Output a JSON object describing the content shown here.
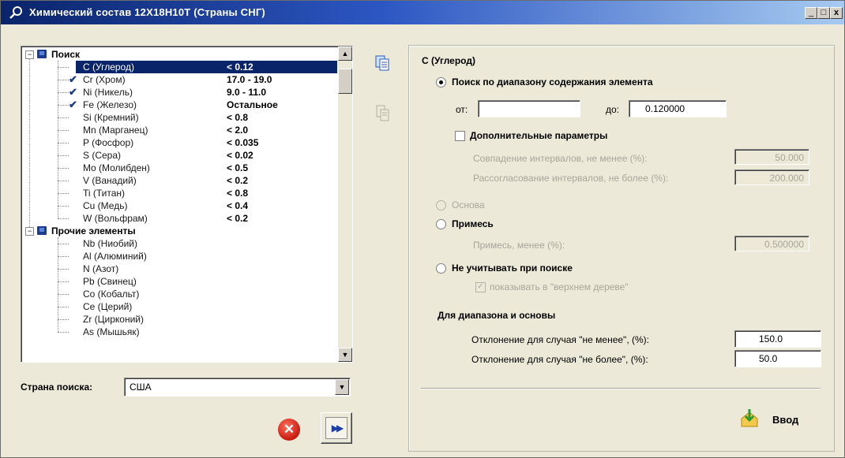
{
  "window": {
    "title": "Химический состав 12Х18Н10Т (Страны СНГ)",
    "min_icon": "_",
    "max_icon": "□",
    "close_icon": "x"
  },
  "tree": {
    "groups": [
      {
        "label": "Поиск",
        "items": [
          {
            "name": "C (Углерод)",
            "value": "< 0.12",
            "checked": false,
            "selected": true
          },
          {
            "name": "Cr (Хром)",
            "value": "17.0 - 19.0",
            "checked": true
          },
          {
            "name": "Ni (Никель)",
            "value": "9.0 - 11.0",
            "checked": true
          },
          {
            "name": "Fe (Железо)",
            "value": "Остальное",
            "checked": true
          },
          {
            "name": "Si (Кремний)",
            "value": "< 0.8",
            "checked": false
          },
          {
            "name": "Mn (Марганец)",
            "value": "< 2.0",
            "checked": false
          },
          {
            "name": "P (Фосфор)",
            "value": "< 0.035",
            "checked": false
          },
          {
            "name": "S (Сера)",
            "value": "< 0.02",
            "checked": false
          },
          {
            "name": "Mo (Молибден)",
            "value": "< 0.5",
            "checked": false
          },
          {
            "name": "V (Ванадий)",
            "value": "< 0.2",
            "checked": false
          },
          {
            "name": "Ti (Титан)",
            "value": "< 0.8",
            "checked": false
          },
          {
            "name": "Cu (Медь)",
            "value": "< 0.4",
            "checked": false
          },
          {
            "name": "W (Вольфрам)",
            "value": "< 0.2",
            "checked": false
          }
        ]
      },
      {
        "label": "Прочие элементы",
        "items": [
          {
            "name": "Nb (Ниобий)",
            "value": ""
          },
          {
            "name": "Al (Алюминий)",
            "value": ""
          },
          {
            "name": "N (Азот)",
            "value": ""
          },
          {
            "name": "Pb (Свинец)",
            "value": ""
          },
          {
            "name": "Co (Кобальт)",
            "value": ""
          },
          {
            "name": "Ce (Церий)",
            "value": ""
          },
          {
            "name": "Zr (Цирконий)",
            "value": ""
          },
          {
            "name": "As (Мышьяк)",
            "value": ""
          }
        ]
      }
    ]
  },
  "country": {
    "label": "Страна поиска:",
    "value": "США"
  },
  "panel": {
    "title": "C (Углерод)",
    "range_search": {
      "label": "Поиск по диапазону содержания элемента",
      "selected": true
    },
    "from_label": "от:",
    "from_value": "",
    "to_label": "до:",
    "to_value": "0.120000",
    "extra_params": {
      "label": "Дополнительные параметры",
      "checked": false
    },
    "overlap": {
      "label": "Совпадение интервалов, не менее (%):",
      "value": "50.000"
    },
    "mismatch": {
      "label": "Рассогласование интервалов, не более (%):",
      "value": "200.000"
    },
    "base": {
      "label": "Основа"
    },
    "impurity": {
      "label": "Примесь"
    },
    "impurity_less": {
      "label": "Примесь, менее (%):",
      "value": "0.500000"
    },
    "ignore": {
      "label": "Не учитывать при поиске"
    },
    "show_top_tree": {
      "label": "показывать в \"верхнем дереве\"",
      "checked": true
    },
    "range_base_header": "Для диапазона и основы",
    "dev_min": {
      "label": "Отклонение для случая \"не менее\", (%):",
      "value": "150.0"
    },
    "dev_max": {
      "label": "Отклонение для случая \"не более\", (%):",
      "value": "50.0"
    },
    "enter_label": "Ввод"
  },
  "icons": [
    "app-icon",
    "paste-icon",
    "copy-icon",
    "cancel-icon",
    "next-icon",
    "enter-icon"
  ]
}
